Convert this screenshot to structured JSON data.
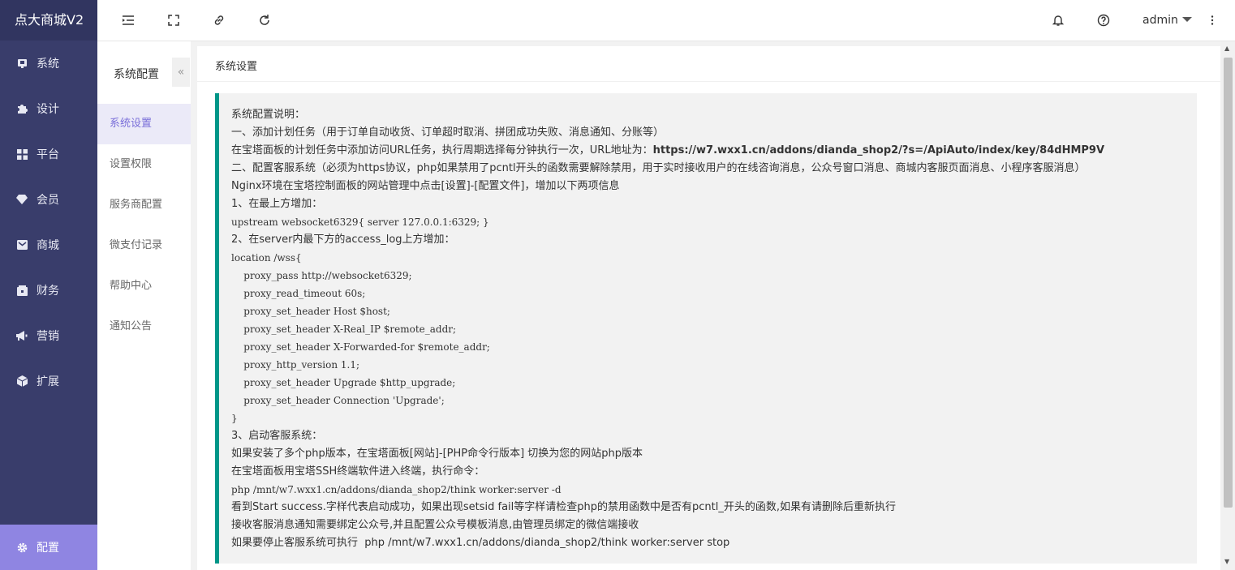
{
  "app": {
    "title": "点大商城V2"
  },
  "sidebar": {
    "items": [
      {
        "label": "系统",
        "icon": "monitor-icon"
      },
      {
        "label": "设计",
        "icon": "puzzle-icon"
      },
      {
        "label": "平台",
        "icon": "grid-icon"
      },
      {
        "label": "会员",
        "icon": "diamond-icon"
      },
      {
        "label": "商城",
        "icon": "mail-icon"
      },
      {
        "label": "财务",
        "icon": "wallet-icon"
      },
      {
        "label": "营销",
        "icon": "megaphone-icon"
      },
      {
        "label": "扩展",
        "icon": "cube-icon"
      }
    ],
    "active": {
      "label": "配置",
      "icon": "gear-icon"
    }
  },
  "submenu": {
    "title": "系统配置",
    "collapse_glyph": "«",
    "items": [
      "系统设置",
      "设置权限",
      "服务商配置",
      "微支付记录",
      "帮助中心",
      "通知公告"
    ]
  },
  "header": {
    "user": "admin"
  },
  "panel": {
    "title": "系统设置",
    "lines": [
      {
        "text": "系统配置说明："
      },
      {
        "text": "一、添加计划任务（用于订单自动收货、订单超时取消、拼团成功失败、消息通知、分账等）"
      },
      {
        "text": "在宝塔面板的计划任务中添加访问URL任务，执行周期选择每分钟执行一次，URL地址为：",
        "bold": "https://w7.wxx1.cn/addons/dianda_shop2/?s=/ApiAuto/index/key/84dHMP9V"
      },
      {
        "text": "二、配置客服系统（必须为https协议，php如果禁用了pcntl开头的函数需要解除禁用，用于实时接收用户的在线咨询消息，公众号窗口消息、商城内客服页面消息、小程序客服消息）"
      },
      {
        "text": "Nginx环境在宝塔控制面板的网站管理中点击[设置]-[配置文件]，增加以下两项信息"
      },
      {
        "text": "1、在最上方增加："
      },
      {
        "text": "upstream websocket6329{ server 127.0.0.1:6329; }",
        "mono": true
      },
      {
        "text": "2、在server内最下方的access_log上方增加："
      },
      {
        "text": "location /wss{",
        "mono": true
      },
      {
        "text": "    proxy_pass http://websocket6329;",
        "mono": true
      },
      {
        "text": "    proxy_read_timeout 60s;",
        "mono": true
      },
      {
        "text": "    proxy_set_header Host $host;",
        "mono": true
      },
      {
        "text": "    proxy_set_header X-Real_IP $remote_addr;",
        "mono": true
      },
      {
        "text": "    proxy_set_header X-Forwarded-for $remote_addr;",
        "mono": true
      },
      {
        "text": "    proxy_http_version 1.1;",
        "mono": true
      },
      {
        "text": "    proxy_set_header Upgrade $http_upgrade;",
        "mono": true
      },
      {
        "text": "    proxy_set_header Connection 'Upgrade';",
        "mono": true
      },
      {
        "text": "}",
        "mono": true
      },
      {
        "text": "3、启动客服系统："
      },
      {
        "text": "如果安装了多个php版本，在宝塔面板[网站]-[PHP命令行版本] 切换为您的网站php版本"
      },
      {
        "text": "在宝塔面板用宝塔SSH终端软件进入终端，执行命令："
      },
      {
        "text": "php /mnt/w7.wxx1.cn/addons/dianda_shop2/think worker:server -d",
        "mono": true
      },
      {
        "text": "看到Start success.字样代表启动成功，如果出现setsid fail等字样请检查php的禁用函数中是否有pcntl_开头的函数,如果有请删除后重新执行"
      },
      {
        "text": "接收客服消息通知需要绑定公众号,并且配置公众号模板消息,由管理员绑定的微信端接收"
      },
      {
        "text": "如果要停止客服系统可执行  php /mnt/w7.wxx1.cn/addons/dianda_shop2/think worker:server stop"
      }
    ]
  },
  "colors": {
    "sidebar": "#393d6b",
    "active": "#8f85e2",
    "accent_border": "#009688"
  }
}
